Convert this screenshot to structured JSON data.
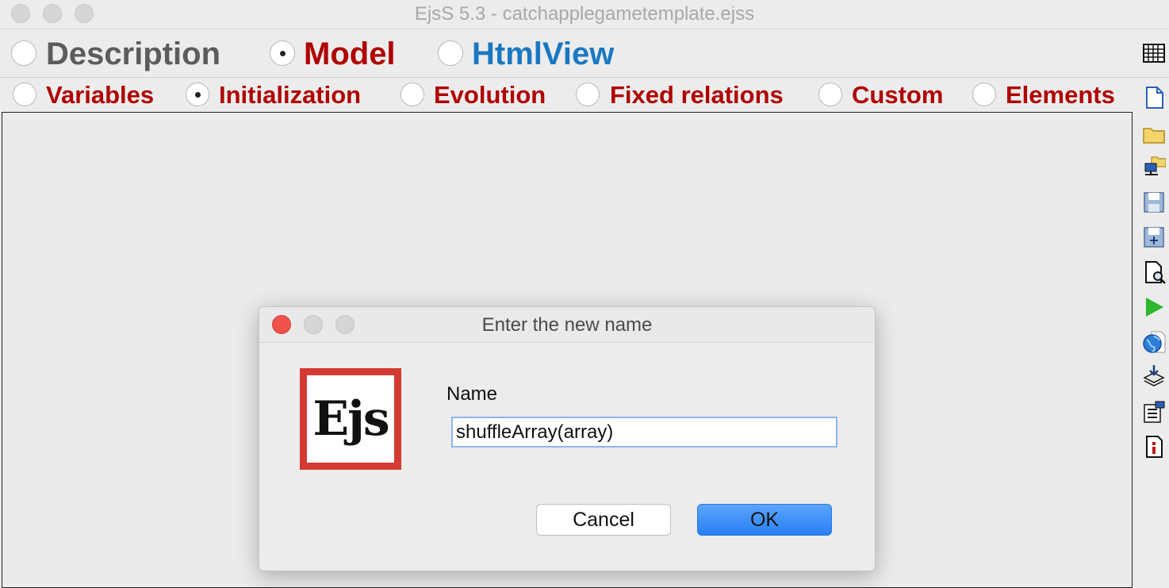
{
  "window": {
    "title": "EjsS 5.3 - catchapplegametemplate.ejss"
  },
  "main_tabs": [
    {
      "label": "Description",
      "selected": false,
      "color": "#5c5c5c"
    },
    {
      "label": "Model",
      "selected": true,
      "color": "#b00000"
    },
    {
      "label": "HtmlView",
      "selected": false,
      "color": "#1a78c2"
    }
  ],
  "sub_tabs": [
    {
      "label": "Variables",
      "selected": false
    },
    {
      "label": "Initialization",
      "selected": true
    },
    {
      "label": "Evolution",
      "selected": false
    },
    {
      "label": "Fixed relations",
      "selected": false
    },
    {
      "label": "Custom",
      "selected": false
    },
    {
      "label": "Elements",
      "selected": false
    }
  ],
  "toolbar_icons": [
    "table-icon",
    "new-file-icon",
    "open-folder-icon",
    "open-remote-icon",
    "save-icon",
    "save-as-icon",
    "search-file-icon",
    "run-icon",
    "web-icon",
    "download-icon",
    "options-icon",
    "info-icon"
  ],
  "dialog": {
    "title": "Enter the new name",
    "logo_text": "Ejs",
    "field_label": "Name",
    "field_value": "shuffleArray(array)",
    "cancel_label": "Cancel",
    "ok_label": "OK"
  },
  "colors": {
    "accent_red": "#b00000",
    "accent_blue": "#1a78c2",
    "ok_button": "#2a7ff5",
    "logo_border": "#d33a32"
  }
}
